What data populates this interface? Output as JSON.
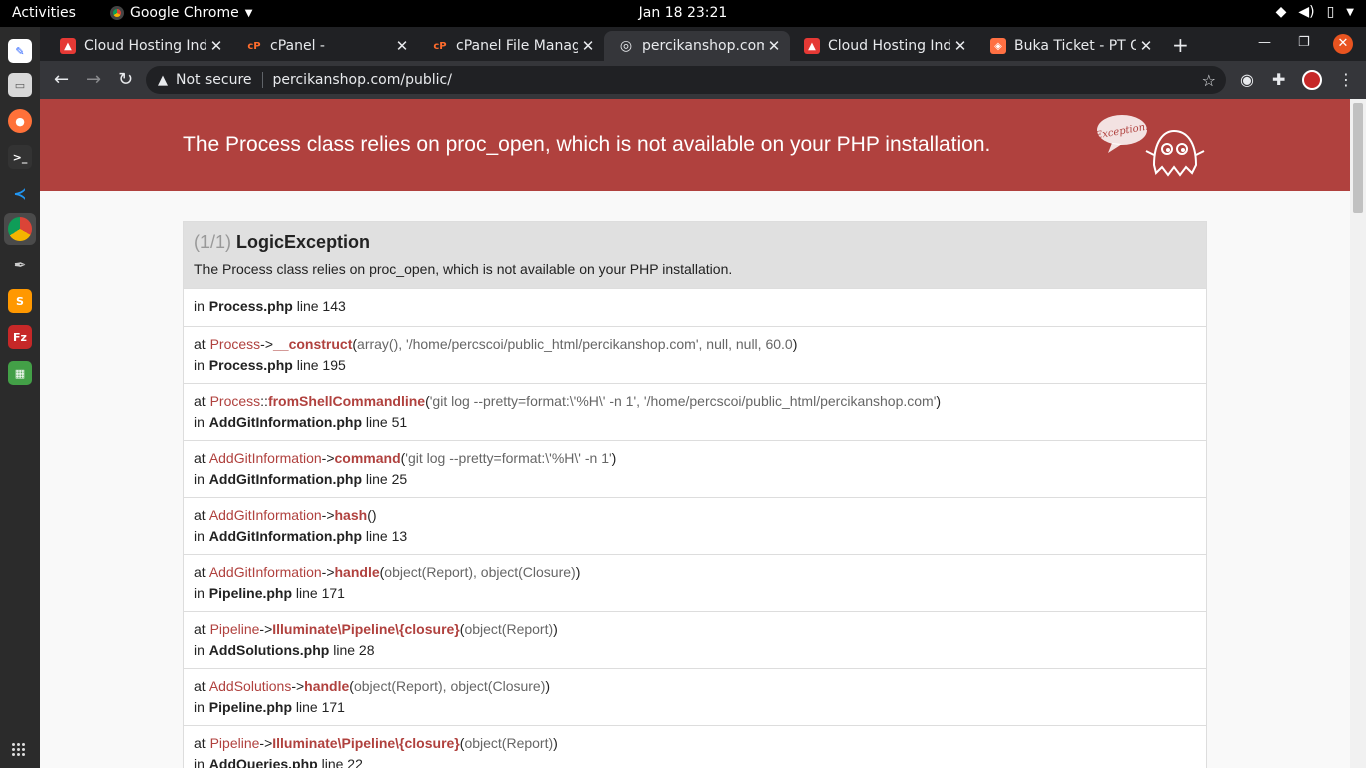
{
  "topbar": {
    "activities": "Activities",
    "app_name": "Google Chrome",
    "clock": "Jan 18  23:21"
  },
  "tabs": [
    {
      "title": "Cloud Hosting Ind",
      "favicon": "cloudhost-icon",
      "active": false
    },
    {
      "title": "cPanel -",
      "favicon": "cpanel-icon",
      "active": false
    },
    {
      "title": "cPanel File Manag",
      "favicon": "cpanel-icon",
      "active": false
    },
    {
      "title": "percikanshop.com",
      "favicon": "globe-icon",
      "active": true
    },
    {
      "title": "Cloud Hosting Ind",
      "favicon": "cloudhost-icon",
      "active": false
    },
    {
      "title": "Buka Ticket - PT Q",
      "favicon": "ticket-icon",
      "active": false
    }
  ],
  "omnibox": {
    "security": "Not secure",
    "url": "percikanshop.com/public/"
  },
  "page": {
    "banner_title": "The Process class relies on proc_open, which is not available on your PHP installation.",
    "ghost_label": "Exception!",
    "exception": {
      "count": "(1/1)",
      "name": "LogicException",
      "message": "The Process class relies on proc_open, which is not available on your PHP installation."
    },
    "first_frame": {
      "prefix": "in",
      "file": "Process.php",
      "line": "line 143"
    },
    "frames": [
      {
        "at": "at",
        "cls": "Process",
        "op": "->",
        "fn": "__construct",
        "args_pre": "(",
        "args": "array(), '/home/percscoi/public_html/percikanshop.com', null, null, 60.0",
        "args_post": ")",
        "in": "in",
        "file": "Process.php",
        "line": "line 195"
      },
      {
        "at": "at",
        "cls": "Process",
        "op": "::",
        "fn": "fromShellCommandline",
        "args_pre": "(",
        "args": "'git log --pretty=format:\\'%H\\' -n 1', '/home/percscoi/public_html/percikanshop.com'",
        "args_post": ")",
        "in": "in",
        "file": "AddGitInformation.php",
        "line": "line 51"
      },
      {
        "at": "at",
        "cls": "AddGitInformation",
        "op": "->",
        "fn": "command",
        "args_pre": "(",
        "args": "'git log --pretty=format:\\'%H\\' -n 1'",
        "args_post": ")",
        "in": "in",
        "file": "AddGitInformation.php",
        "line": "line 25"
      },
      {
        "at": "at",
        "cls": "AddGitInformation",
        "op": "->",
        "fn": "hash",
        "args_pre": "(",
        "args": "",
        "args_post": ")",
        "in": "in",
        "file": "AddGitInformation.php",
        "line": "line 13"
      },
      {
        "at": "at",
        "cls": "AddGitInformation",
        "op": "->",
        "fn": "handle",
        "args_pre": "(",
        "args": "object(Report), object(Closure)",
        "args_post": ")",
        "in": "in",
        "file": "Pipeline.php",
        "line": "line 171"
      },
      {
        "at": "at",
        "cls": "Pipeline",
        "op": "->",
        "fn": "Illuminate\\Pipeline\\{closure}",
        "args_pre": "(",
        "args": "object(Report)",
        "args_post": ")",
        "in": "in",
        "file": "AddSolutions.php",
        "line": "line 28"
      },
      {
        "at": "at",
        "cls": "AddSolutions",
        "op": "->",
        "fn": "handle",
        "args_pre": "(",
        "args": "object(Report), object(Closure)",
        "args_post": ")",
        "in": "in",
        "file": "Pipeline.php",
        "line": "line 171"
      },
      {
        "at": "at",
        "cls": "Pipeline",
        "op": "->",
        "fn": "Illuminate\\Pipeline\\{closure}",
        "args_pre": "(",
        "args": "object(Report)",
        "args_post": ")",
        "in": "in",
        "file": "AddQueries.php",
        "line": "line 22"
      }
    ]
  },
  "colors": {
    "banner": "#b0413e",
    "accent": "#b0413e",
    "tabstrip": "#202124",
    "toolbar": "#35363a"
  }
}
